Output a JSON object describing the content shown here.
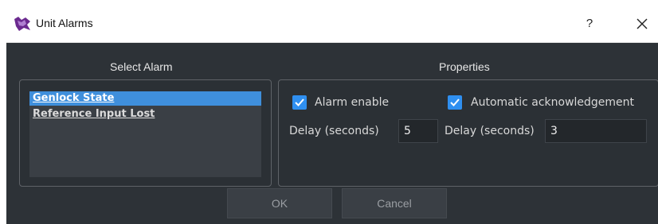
{
  "window": {
    "title": "Unit Alarms",
    "help_label": "?",
    "icon": "app-logo-icon"
  },
  "select_alarm": {
    "title": "Select Alarm",
    "items": [
      {
        "label": "Genlock State",
        "selected": true
      },
      {
        "label": "Reference Input Lost",
        "selected": false
      }
    ]
  },
  "properties": {
    "title": "Properties",
    "alarm_enable": {
      "label": "Alarm enable",
      "checked": true
    },
    "auto_ack": {
      "label": "Automatic acknowledgement",
      "checked": true
    },
    "delay_left": {
      "label": "Delay (seconds)",
      "value": "5"
    },
    "delay_right": {
      "label": "Delay (seconds)",
      "value": "3"
    }
  },
  "buttons": {
    "ok": "OK",
    "cancel": "Cancel"
  },
  "colors": {
    "accent": "#2f8ff0",
    "selection": "#3f8fdc",
    "background": "#2d3237"
  }
}
